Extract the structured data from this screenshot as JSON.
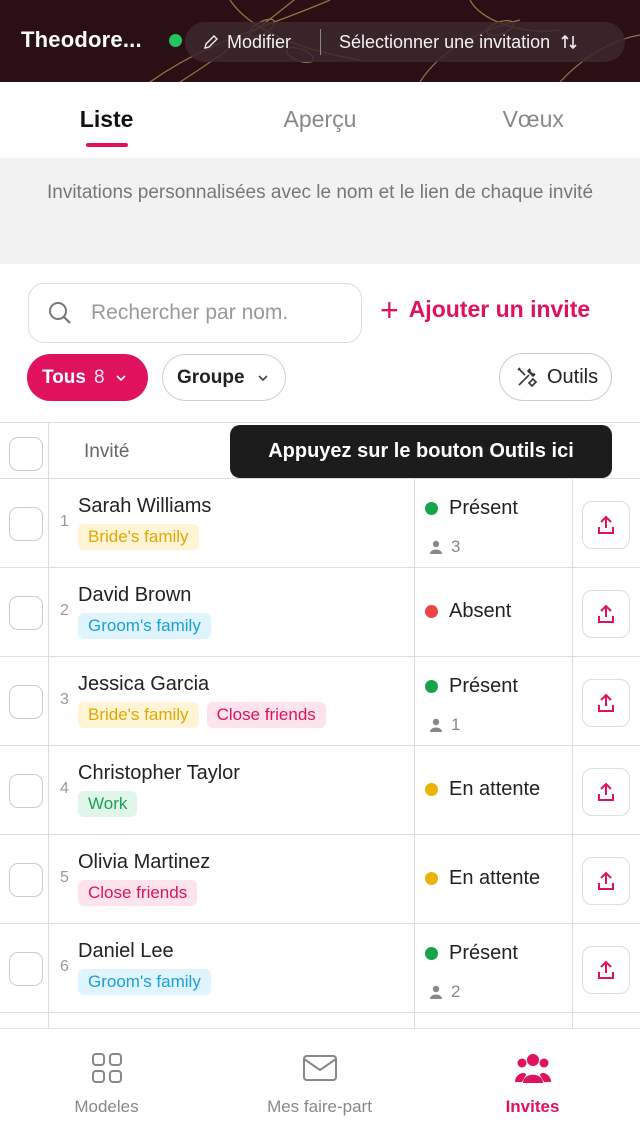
{
  "header": {
    "title": "Theodore...",
    "edit_label": "Modifier",
    "select_label": "Sélectionner une invitation"
  },
  "tabs": [
    {
      "label": "Liste",
      "active": true
    },
    {
      "label": "Aperçu",
      "active": false
    },
    {
      "label": "Vœux",
      "active": false
    }
  ],
  "info_text": "Invitations personnalisées avec le nom et le lien de chaque invité",
  "search": {
    "placeholder": "Rechercher par nom."
  },
  "add_invite_label": "Ajouter un invite",
  "filters": {
    "all_label": "Tous",
    "all_count": "8",
    "group_label": "Groupe",
    "tools_label": "Outils"
  },
  "table": {
    "col_guest": "Invité",
    "rows": [
      {
        "num": "1",
        "name": "Sarah Williams",
        "tags": [
          {
            "label": "Bride's family",
            "kind": "bride"
          }
        ],
        "status": "Présent",
        "status_color": "#16a34a",
        "guests": "3"
      },
      {
        "num": "2",
        "name": "David Brown",
        "tags": [
          {
            "label": "Groom's family",
            "kind": "groom"
          }
        ],
        "status": "Absent",
        "status_color": "#ef4444",
        "guests": null
      },
      {
        "num": "3",
        "name": "Jessica Garcia",
        "tags": [
          {
            "label": "Bride's family",
            "kind": "bride"
          },
          {
            "label": "Close friends",
            "kind": "close"
          }
        ],
        "status": "Présent",
        "status_color": "#16a34a",
        "guests": "1"
      },
      {
        "num": "4",
        "name": "Christopher Taylor",
        "tags": [
          {
            "label": "Work",
            "kind": "work"
          }
        ],
        "status": "En attente",
        "status_color": "#eab308",
        "guests": null
      },
      {
        "num": "5",
        "name": "Olivia Martinez",
        "tags": [
          {
            "label": "Close friends",
            "kind": "close"
          }
        ],
        "status": "En attente",
        "status_color": "#eab308",
        "guests": null
      },
      {
        "num": "6",
        "name": "Daniel Lee",
        "tags": [
          {
            "label": "Groom's family",
            "kind": "groom"
          }
        ],
        "status": "Présent",
        "status_color": "#16a34a",
        "guests": "2"
      }
    ]
  },
  "tooltip": "Appuyez sur le bouton Outils ici",
  "bottom_nav": [
    {
      "label": "Modeles",
      "icon": "grid-icon",
      "active": false
    },
    {
      "label": "Mes faire-part",
      "icon": "envelope-icon",
      "active": false
    },
    {
      "label": "Invites",
      "icon": "people-icon",
      "active": true
    }
  ],
  "colors": {
    "accent": "#e0115f",
    "header_bg": "#2a0f14"
  }
}
